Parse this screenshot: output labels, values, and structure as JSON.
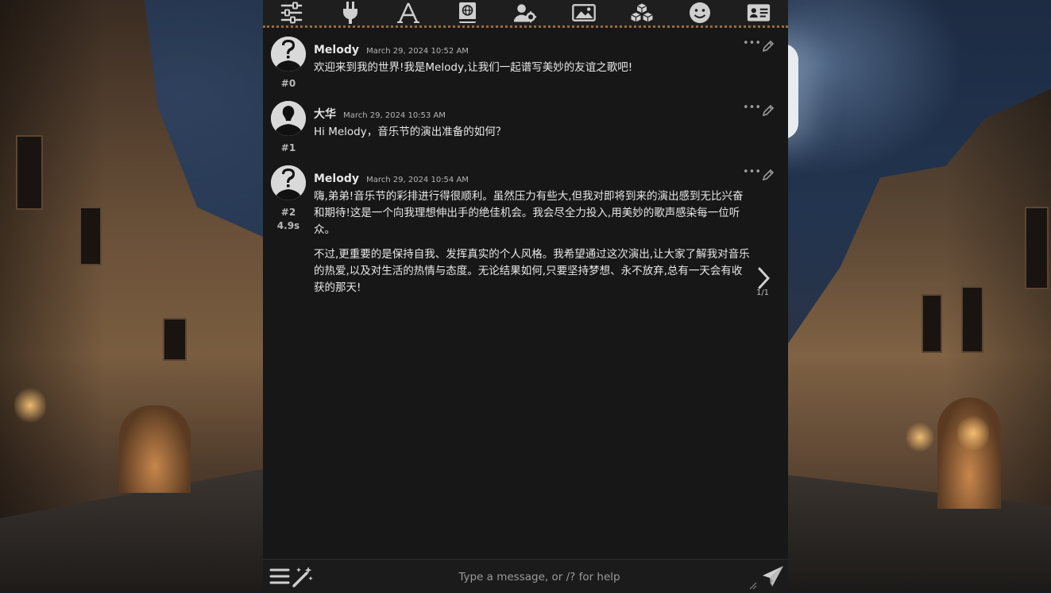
{
  "topbar": {
    "icons": [
      "ai-response-config-icon",
      "api-connections-icon",
      "formatting-icon",
      "world-info-icon",
      "user-settings-icon",
      "backgrounds-icon",
      "extensions-icon",
      "persona-icon",
      "character-management-icon"
    ]
  },
  "messages": [
    {
      "name": "Melody",
      "date": "March 29, 2024 10:52 AM",
      "index": "#0",
      "gen_time": "",
      "paragraphs": [
        "欢迎来到我的世界!我是Melody,让我们一起谱写美妙的友谊之歌吧!"
      ]
    },
    {
      "name": "大华",
      "date": "March 29, 2024 10:53 AM",
      "index": "#1",
      "gen_time": "",
      "paragraphs": [
        "Hi Melody，音乐节的演出准备的如何？"
      ]
    },
    {
      "name": "Melody",
      "date": "March 29, 2024 10:54 AM",
      "index": "#2",
      "gen_time": "4.9s",
      "paragraphs": [
        "嗨,弟弟!音乐节的彩排进行得很顺利。虽然压力有些大,但我对即将到来的演出感到无比兴奋和期待!这是一个向我理想伸出手的绝佳机会。我会尽全力投入,用美妙的歌声感染每一位听众。",
        "不过,更重要的是保持自我、发挥真实的个人风格。我希望通过这次演出,让大家了解我对音乐的热爱,以及对生活的热情与态度。无论结果如何,只要坚持梦想、永不放弃,总有一天会有收获的那天!"
      ],
      "swipe_counter": "1/1"
    }
  ],
  "input": {
    "placeholder": "Type a message, or /? for help",
    "value": ""
  },
  "colors": {
    "panel_bg": "#171717",
    "topbar_border": "#9a6a3c",
    "text": "#e8e8e8"
  }
}
